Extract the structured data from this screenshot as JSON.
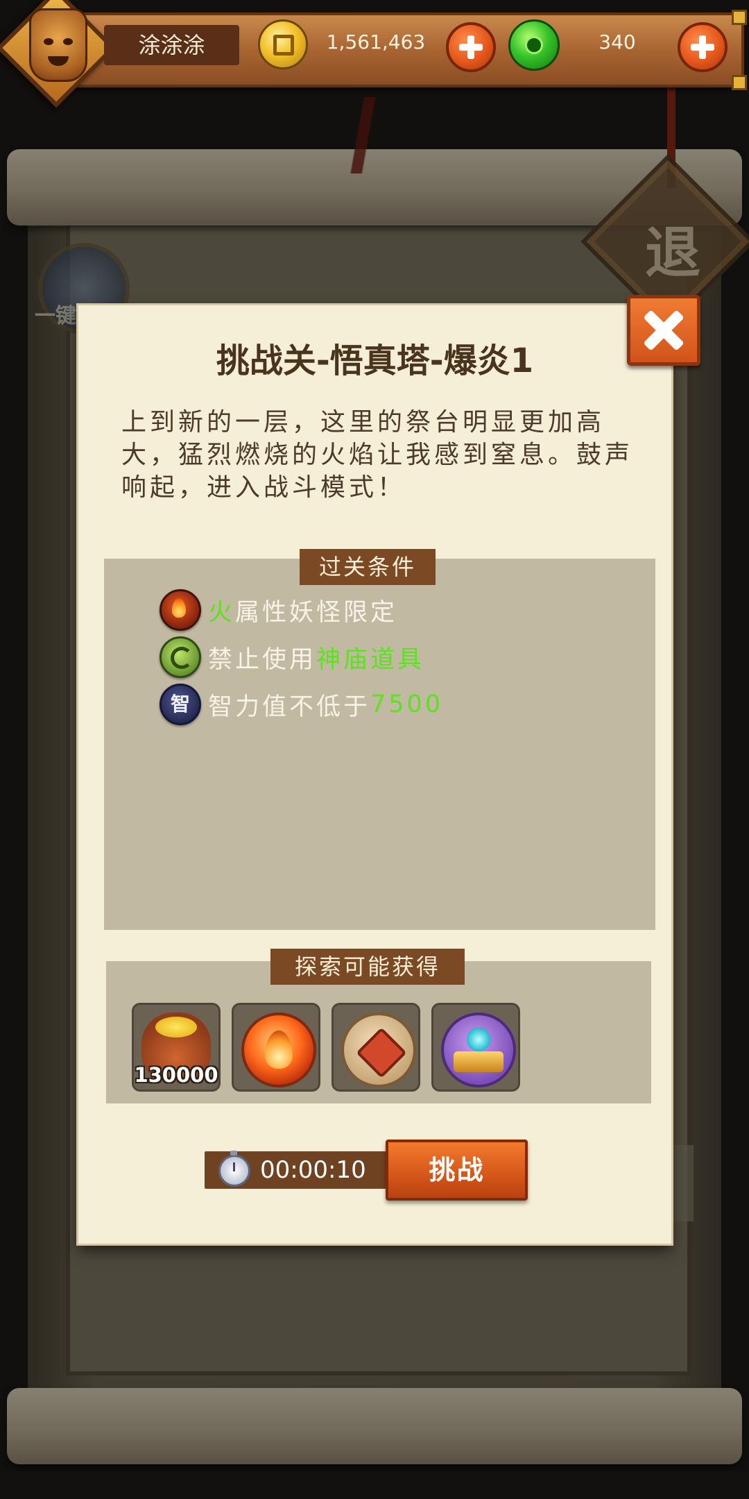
{
  "player": {
    "name": "涂涂涂",
    "coins": "1,561,463",
    "jade": "340"
  },
  "background": {
    "exit_label": "退",
    "side_label": "一键"
  },
  "dialog": {
    "title": "挑战关-悟真塔-爆炎1",
    "description": "上到新的一层，这里的祭台明显更加高大，猛烈燃烧的火焰让我感到窒息。鼓声响起，进入战斗模式！",
    "conditions_label": "过关条件",
    "conditions": [
      {
        "icon": "fire-element-icon",
        "highlight": "火",
        "text": "属性妖怪限定"
      },
      {
        "icon": "temple-item-icon",
        "text": "禁止使用",
        "highlight": "神庙道具"
      },
      {
        "icon": "intelligence-icon",
        "icon_label": "智",
        "text": "智力值不低于",
        "highlight": "7500"
      }
    ],
    "rewards_label": "探索可能获得",
    "rewards": [
      {
        "icon": "gold-bag-icon",
        "quantity": "130000"
      },
      {
        "icon": "fire-orb-icon"
      },
      {
        "icon": "strength-emblem-icon"
      },
      {
        "icon": "crown-orb-icon"
      }
    ],
    "timer": "00:00:10",
    "challenge_label": "挑战"
  },
  "colors": {
    "highlight_green": "#5fe021",
    "accent_orange": "#d4561a",
    "panel_gray": "#c2b9a3",
    "paper": "#f6efd8"
  }
}
